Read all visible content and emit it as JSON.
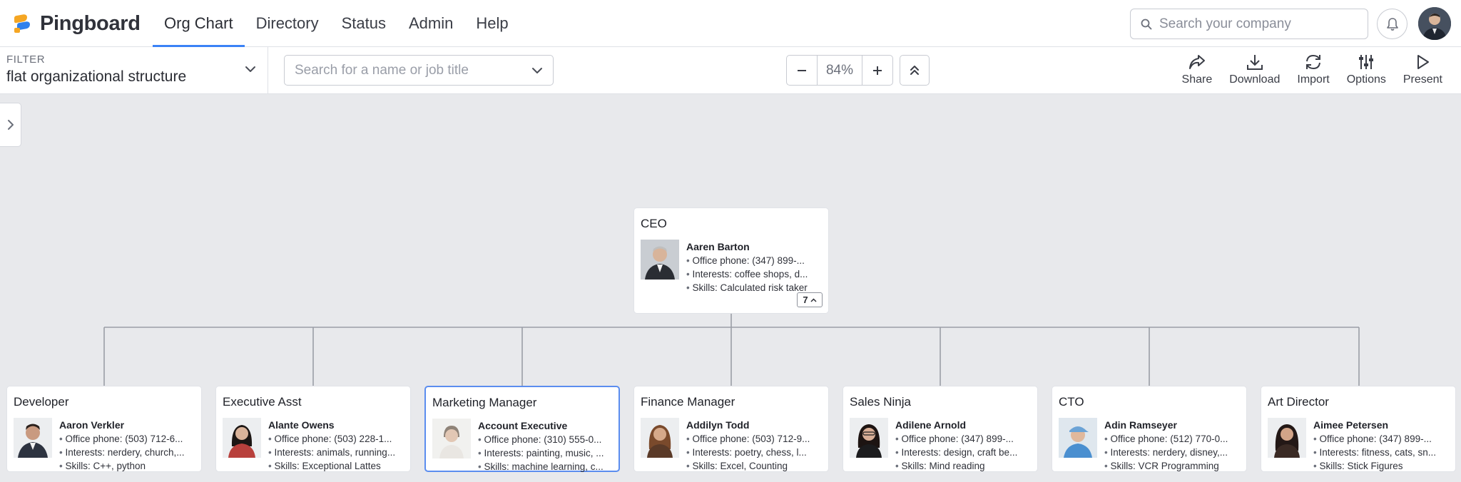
{
  "brand": {
    "name": "Pingboard"
  },
  "nav": {
    "items": [
      {
        "label": "Org Chart",
        "active": true
      },
      {
        "label": "Directory",
        "active": false
      },
      {
        "label": "Status",
        "active": false
      },
      {
        "label": "Admin",
        "active": false
      },
      {
        "label": "Help",
        "active": false
      }
    ]
  },
  "header": {
    "search_placeholder": "Search your company"
  },
  "toolbar": {
    "filter_label": "FILTER",
    "filter_value": "flat organizational structure",
    "name_search_placeholder": "Search for a name or job title",
    "zoom": "84%",
    "actions": [
      {
        "label": "Share",
        "icon": "share-icon"
      },
      {
        "label": "Download",
        "icon": "download-icon"
      },
      {
        "label": "Import",
        "icon": "refresh-icon"
      },
      {
        "label": "Options",
        "icon": "sliders-icon"
      },
      {
        "label": "Present",
        "icon": "play-icon"
      }
    ]
  },
  "ceo": {
    "title": "CEO",
    "name": "Aaren Barton",
    "phone": "Office phone: (347) 899-...",
    "interests": "Interests: coffee shops, d...",
    "skills": "Skills: Calculated risk taker",
    "reports": "7"
  },
  "reports": [
    {
      "title": "Developer",
      "name": "Aaron Verkler",
      "phone": "Office phone: (503) 712-6...",
      "interests": "Interests: nerdery, church,...",
      "skills": "Skills: C++, python"
    },
    {
      "title": "Executive Asst",
      "name": "Alante Owens",
      "phone": "Office phone: (503) 228-1...",
      "interests": "Interests: animals, running...",
      "skills": "Skills: Exceptional Lattes"
    },
    {
      "title": "Marketing Manager",
      "name": "Account Executive",
      "phone": "Office phone: (310) 555-0...",
      "interests": "Interests: painting, music, ...",
      "skills": "Skills: machine learning, c..."
    },
    {
      "title": "Finance Manager",
      "name": "Addilyn Todd",
      "phone": "Office phone: (503) 712-9...",
      "interests": "Interests: poetry, chess, l...",
      "skills": "Skills: Excel, Counting"
    },
    {
      "title": "Sales Ninja",
      "name": "Adilene Arnold",
      "phone": "Office phone: (347) 899-...",
      "interests": "Interests: design, craft be...",
      "skills": "Skills: Mind reading"
    },
    {
      "title": "CTO",
      "name": "Adin Ramseyer",
      "phone": "Office phone: (512) 770-0...",
      "interests": "Interests: nerdery, disney,...",
      "skills": "Skills: VCR Programming"
    },
    {
      "title": "Art Director",
      "name": "Aimee Petersen",
      "phone": "Office phone: (347) 899-...",
      "interests": "Interests: fitness, cats, sn...",
      "skills": "Skills: Stick Figures"
    }
  ],
  "colors": {
    "accent": "#3b82f6",
    "selected_border": "#5b8def",
    "canvas": "#e8e9ec"
  }
}
